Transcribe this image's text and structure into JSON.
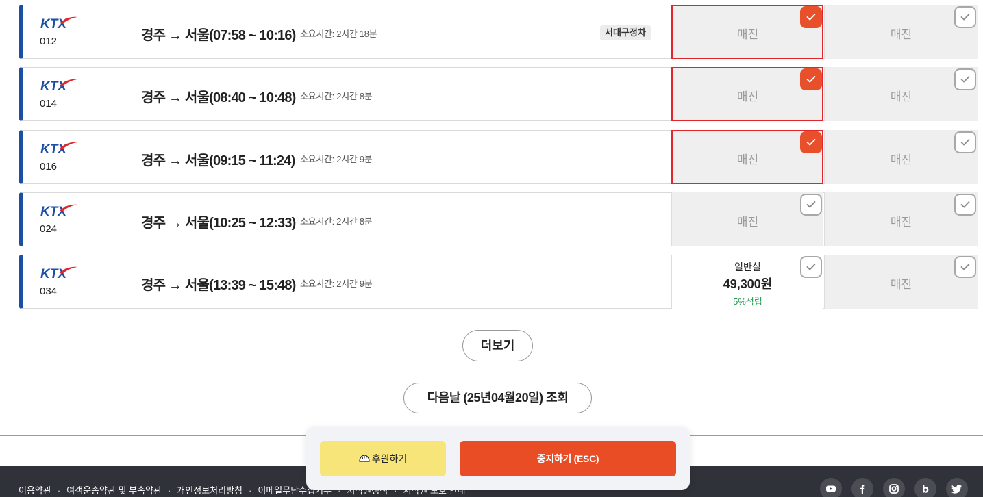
{
  "trains": [
    {
      "brand": "KTX",
      "number": "012",
      "route": "경주 → 서울(07:58 ~ 10:16)",
      "duration": "소요시간: 2시간 18분",
      "badge": "서대구정차",
      "general": {
        "status": "매진",
        "checked": true
      },
      "special": {
        "status": "매진",
        "checked": false
      }
    },
    {
      "brand": "KTX",
      "number": "014",
      "route": "경주 → 서울(08:40 ~ 10:48)",
      "duration": "소요시간: 2시간 8분",
      "badge": "",
      "general": {
        "status": "매진",
        "checked": true
      },
      "special": {
        "status": "매진",
        "checked": false
      }
    },
    {
      "brand": "KTX",
      "number": "016",
      "route": "경주 → 서울(09:15 ~ 11:24)",
      "duration": "소요시간: 2시간 9분",
      "badge": "",
      "general": {
        "status": "매진",
        "checked": true
      },
      "special": {
        "status": "매진",
        "checked": false
      }
    },
    {
      "brand": "KTX",
      "number": "024",
      "route": "경주 → 서울(10:25 ~ 12:33)",
      "duration": "소요시간: 2시간 8분",
      "badge": "",
      "general": {
        "status": "매진",
        "checked": false
      },
      "special": {
        "status": "매진",
        "checked": false
      }
    },
    {
      "brand": "KTX",
      "number": "034",
      "route": "경주 → 서울(13:39 ~ 15:48)",
      "duration": "소요시간: 2시간 9분",
      "badge": "",
      "general": {
        "status": "available",
        "class": "일반실",
        "price": "49,300원",
        "points": "5%적립",
        "checked": false
      },
      "special": {
        "status": "매진",
        "checked": false
      }
    }
  ],
  "buttons": {
    "more": "더보기",
    "next_day": "다음날 (25년04월20일) 조회",
    "donate": "후원하기",
    "stop": "중지하기 (ESC)"
  },
  "footer": {
    "links": [
      "이용약관",
      "여객운송약관 및 부속약관",
      "개인정보처리방침",
      "이메일무단수집거부",
      "저작권정책",
      "저작권 보호 안내"
    ],
    "social": [
      "youtube-icon",
      "facebook-icon",
      "instagram-icon",
      "blog-icon",
      "twitter-icon"
    ]
  },
  "colors": {
    "accent": "#e84d26",
    "selected_border": "#e2262c",
    "ktx_blue": "#1a4fa3",
    "ktx_red": "#e2262c",
    "points_green": "#1e9b4a",
    "donate_yellow": "#f7e57a",
    "footer_bg": "#2f3238"
  }
}
